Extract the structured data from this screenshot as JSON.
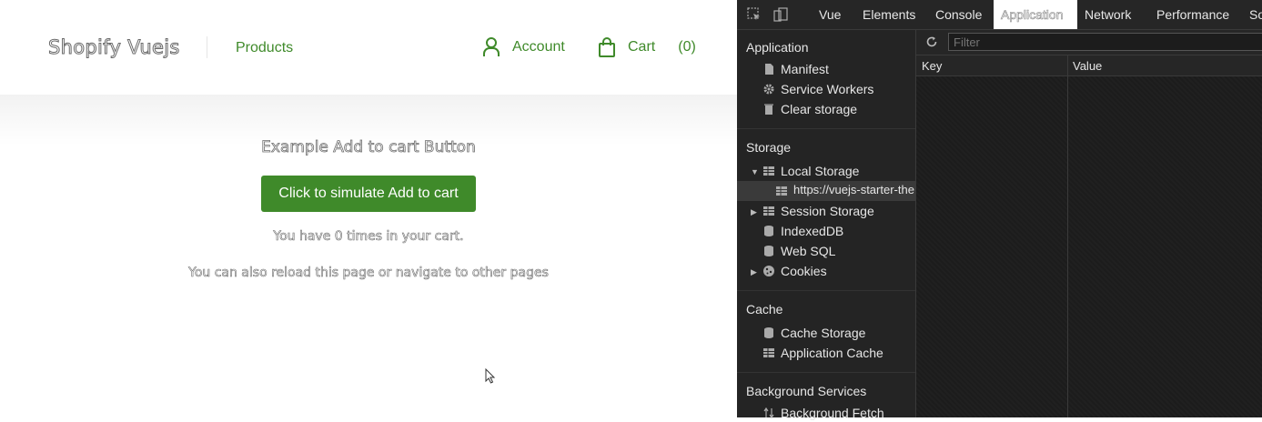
{
  "page": {
    "logo": "Shopify Vuejs",
    "nav": {
      "products": "Products",
      "account": "Account",
      "cart": "Cart",
      "cart_count": "(0)"
    },
    "title": "Example Add to cart Button",
    "add_button": "Click to simulate Add to cart",
    "info_line_1": "You have 0 times in your cart.",
    "info_line_2": "You can also reload this page or navigate to other pages"
  },
  "devtools": {
    "tabs": [
      "Vue",
      "Elements",
      "Console",
      "Application",
      "Network",
      "Performance",
      "So"
    ],
    "active_tab": "Application",
    "sidebar": {
      "application_section": "Application",
      "application_items": [
        "Manifest",
        "Service Workers",
        "Clear storage"
      ],
      "storage_section": "Storage",
      "local_storage": "Local Storage",
      "local_storage_origin": "https://vuejs-starter-the",
      "session_storage": "Session Storage",
      "indexeddb": "IndexedDB",
      "websql": "Web SQL",
      "cookies": "Cookies",
      "cache_section": "Cache",
      "cache_items": [
        "Cache Storage",
        "Application Cache"
      ],
      "bg_section": "Background Services",
      "bg_items": [
        "Background Fetch"
      ]
    },
    "filter_placeholder": "Filter",
    "columns": {
      "key": "Key",
      "value": "Value"
    }
  },
  "colors": {
    "brand_green": "#3f8a2a",
    "devtools_bg": "#1f1f1f"
  }
}
